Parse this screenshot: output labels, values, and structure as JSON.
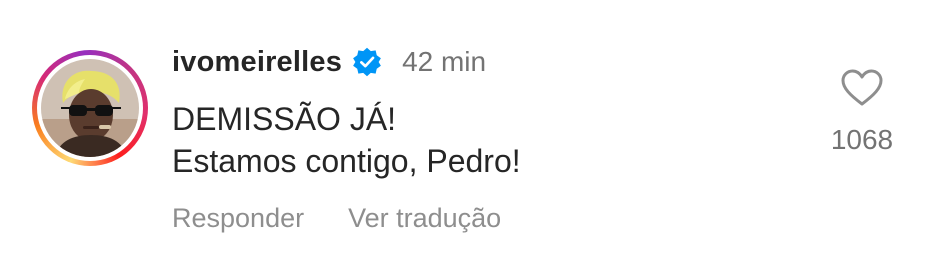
{
  "comment": {
    "username": "ivomeirelles",
    "verified_icon": "verified-badge-icon",
    "time": "42 min",
    "lines": [
      "DEMISSÃO JÁ!",
      "Estamos contigo, Pedro!"
    ],
    "actions": {
      "reply_label": "Responder",
      "translate_label": "Ver tradução"
    },
    "likes": {
      "icon": "heart-outline-icon",
      "count": "1068"
    }
  },
  "colors": {
    "text": "#262626",
    "muted": "#737373",
    "verified": "#0095f6"
  }
}
